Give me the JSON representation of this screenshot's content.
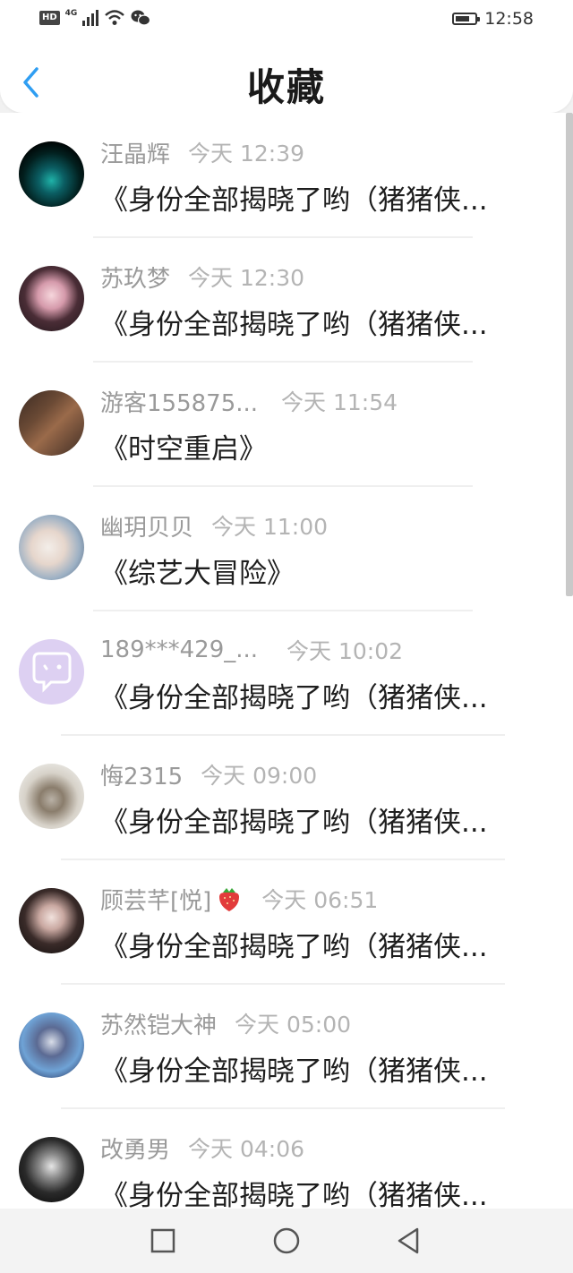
{
  "status_bar": {
    "hd": "HD",
    "network": "4G",
    "time": "12:58"
  },
  "header": {
    "title": "收藏",
    "back_icon": "chevron-left-icon"
  },
  "colors": {
    "accent": "#2f9ef2",
    "name_gray": "#9a9a9a",
    "time_gray": "#b4b4b4"
  },
  "items": [
    {
      "name": "汪晶辉",
      "time": "今天 12:39",
      "message": "《身份全部揭晓了哟（猪猪侠..."
    },
    {
      "name": "苏玖梦",
      "time": "今天 12:30",
      "message": "《身份全部揭晓了哟（猪猪侠..."
    },
    {
      "name": "游客155875...",
      "time": "今天 11:54",
      "message": "《时空重启》"
    },
    {
      "name": "幽玥贝贝",
      "time": "今天 11:00",
      "message": "《综艺大冒险》"
    },
    {
      "name": "189***429_...",
      "time": "今天 10:02",
      "message": "《身份全部揭晓了哟（猪猪侠..."
    },
    {
      "name": "悔2315",
      "time": "今天 09:00",
      "message": "《身份全部揭晓了哟（猪猪侠..."
    },
    {
      "name": "顾芸芊[悦]",
      "time": "今天 06:51",
      "message": "《身份全部揭晓了哟（猪猪侠..."
    },
    {
      "name": "苏然铠大神",
      "time": "今天 05:00",
      "message": "《身份全部揭晓了哟（猪猪侠..."
    },
    {
      "name": "改勇男",
      "time": "今天 04:06",
      "message": "《身份全部揭晓了哟（猪猪侠..."
    }
  ],
  "navigation": [
    "square-recents-icon",
    "circle-home-icon",
    "triangle-back-icon"
  ]
}
